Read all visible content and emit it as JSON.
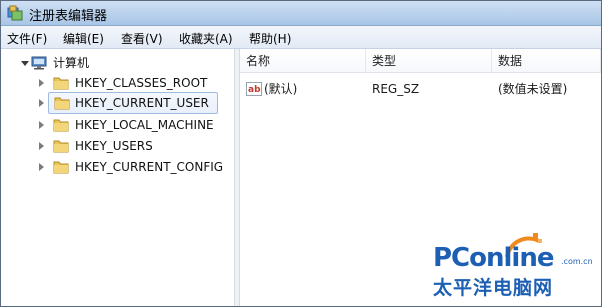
{
  "window": {
    "title": "注册表编辑器"
  },
  "menu": [
    {
      "label": "文件(F)"
    },
    {
      "label": "编辑(E)"
    },
    {
      "label": "查看(V)"
    },
    {
      "label": "收藏夹(A)"
    },
    {
      "label": "帮助(H)"
    }
  ],
  "tree": {
    "root": "计算机",
    "items": [
      {
        "label": "HKEY_CLASSES_ROOT"
      },
      {
        "label": "HKEY_CURRENT_USER"
      },
      {
        "label": "HKEY_LOCAL_MACHINE"
      },
      {
        "label": "HKEY_USERS"
      },
      {
        "label": "HKEY_CURRENT_CONFIG"
      }
    ]
  },
  "list": {
    "columns": [
      "名称",
      "类型",
      "数据"
    ],
    "rows": [
      {
        "name": "(默认)",
        "type": "REG_SZ",
        "data": "(数值未设置)"
      }
    ]
  },
  "watermark": {
    "brand": "PConline",
    "domain": ".com.cn",
    "tagline": "太平洋电脑网"
  },
  "colors": {
    "titlebar": "#b9d1ec",
    "selection_border": "#9ebbe2",
    "folder": "#e9c45a",
    "watermark_blue": "#1d5fb3",
    "watermark_orange": "#f08a1c"
  },
  "icons": {
    "app": "registry-editor-icon",
    "computer": "computer-icon",
    "folder": "folder-icon",
    "string_value": "string-value-icon"
  }
}
